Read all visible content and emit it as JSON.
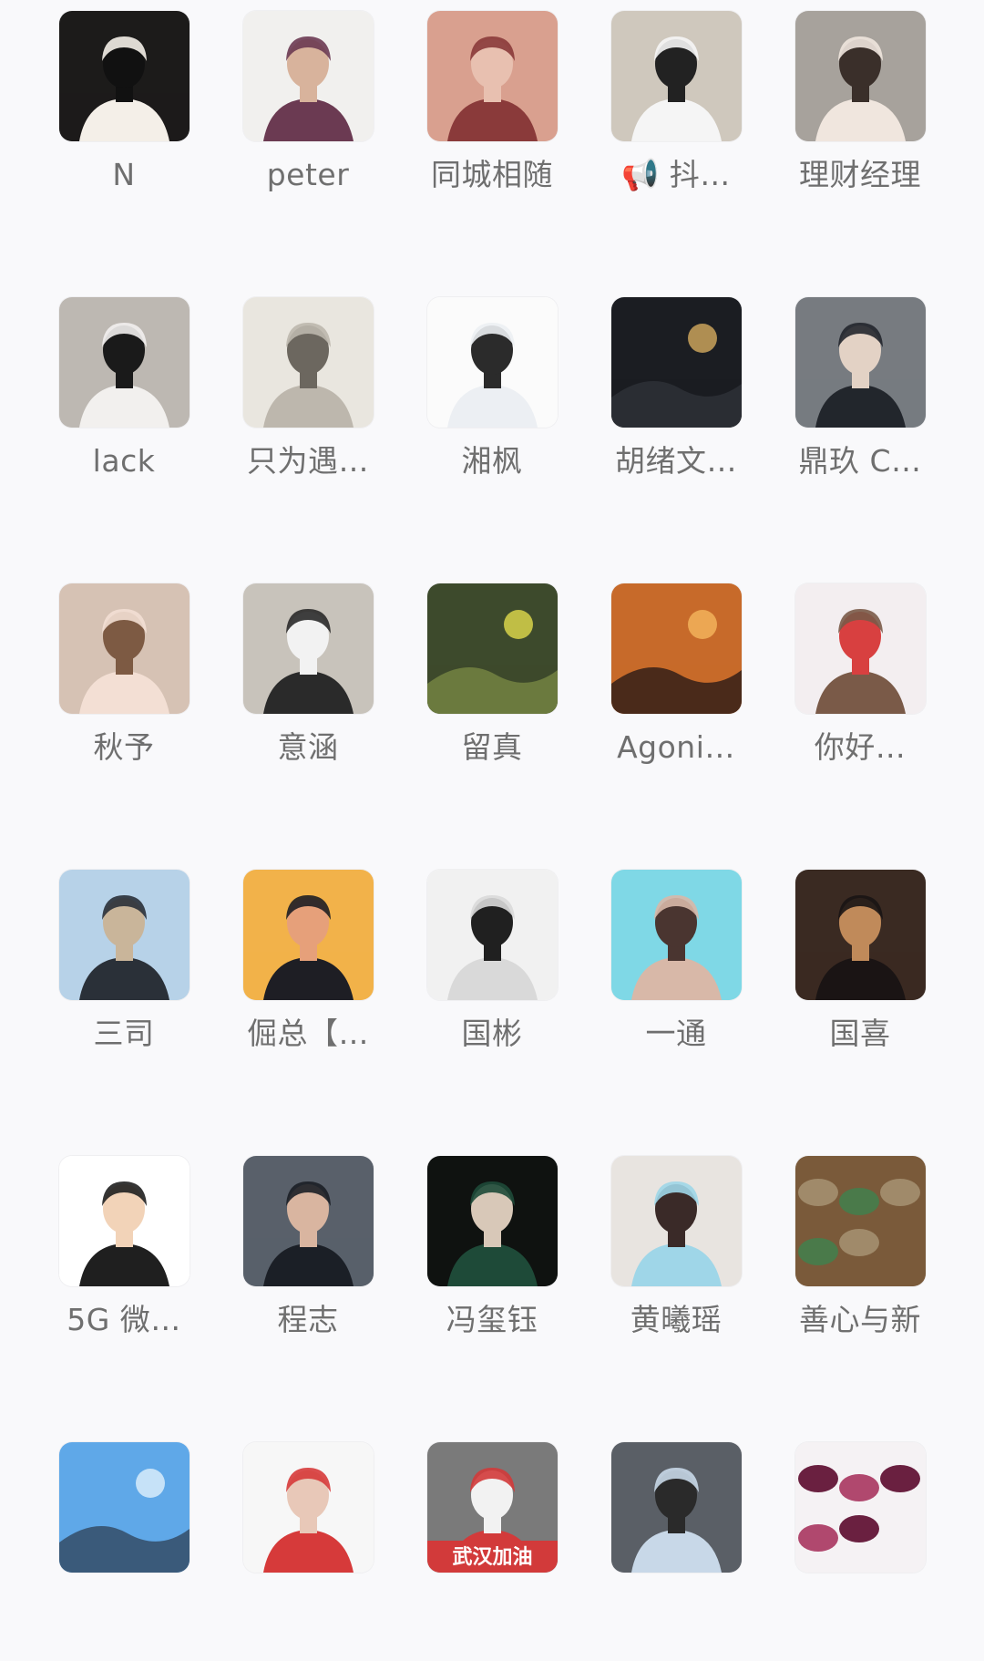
{
  "contacts": [
    {
      "name": "N",
      "icon": "penguin-baby-avatar",
      "colors": [
        "#1c1b1a",
        "#f4efe8",
        "#111111"
      ]
    },
    {
      "name": "peter",
      "icon": "man-portrait-avatar",
      "colors": [
        "#f1f0ee",
        "#6b3a52",
        "#d8b39c"
      ]
    },
    {
      "name": "同城相随",
      "icon": "woman-selfie-avatar",
      "colors": [
        "#d9a08f",
        "#8a3a3a",
        "#e8c0b0"
      ]
    },
    {
      "name": "📢 抖…",
      "icon": "man-sitting-avatar",
      "colors": [
        "#cfc8bd",
        "#f5f5f5",
        "#222222"
      ]
    },
    {
      "name": "理财经理",
      "icon": "woman-scarf-avatar",
      "colors": [
        "#a7a29c",
        "#f0e6de",
        "#3a2f2a"
      ]
    },
    {
      "name": "lack",
      "icon": "cat-sunglasses-avatar",
      "colors": [
        "#bdb8b2",
        "#f2f0ee",
        "#1a1a1a"
      ]
    },
    {
      "name": "只为遇…",
      "icon": "sketch-boy-avatar",
      "colors": [
        "#e9e6df",
        "#bdb7ad",
        "#6c675f"
      ]
    },
    {
      "name": "湘枫",
      "icon": "man-standing-avatar",
      "colors": [
        "#fbfbfb",
        "#eceff3",
        "#2b2b2b"
      ]
    },
    {
      "name": "胡绪文…",
      "icon": "calligraphy-hu-avatar",
      "colors": [
        "#1b1d22",
        "#c9a25a",
        "#2a2d33"
      ]
    },
    {
      "name": "鼎玖 C…",
      "icon": "man-suit-avatar",
      "colors": [
        "#777b80",
        "#22262c",
        "#e3d2c5"
      ]
    },
    {
      "name": "秋予",
      "icon": "girl-face-avatar",
      "colors": [
        "#d6c2b4",
        "#f3dfd4",
        "#7d5a43"
      ]
    },
    {
      "name": "意涵",
      "icon": "woman-office-avatar",
      "colors": [
        "#c8c3bb",
        "#2a2a2a",
        "#f2f2f2"
      ]
    },
    {
      "name": "留真",
      "icon": "clover-avatar",
      "colors": [
        "#3d4a2c",
        "#d7d24a",
        "#6b7a3e"
      ]
    },
    {
      "name": "Agoni…",
      "icon": "sunset-beach-avatar",
      "colors": [
        "#c76a2a",
        "#f2b25a",
        "#4a2a1a"
      ]
    },
    {
      "name": "你好…",
      "icon": "woman-profile-avatar",
      "colors": [
        "#f3eef0",
        "#7a5a48",
        "#d84040"
      ]
    },
    {
      "name": "三司",
      "icon": "man-vest-avatar",
      "colors": [
        "#b7d2e8",
        "#2a3038",
        "#c9b59a"
      ]
    },
    {
      "name": "倔总【…",
      "icon": "anime-ninja-avatar",
      "colors": [
        "#f2b24a",
        "#1e1e24",
        "#e6a07a"
      ]
    },
    {
      "name": "国彬",
      "icon": "man-glasses-avatar",
      "colors": [
        "#f1f1f1",
        "#d9d9d9",
        "#202020"
      ]
    },
    {
      "name": "一通",
      "icon": "woman-video-avatar",
      "colors": [
        "#7fd8e6",
        "#d8b8a8",
        "#4a3530"
      ]
    },
    {
      "name": "国喜",
      "icon": "man-chair-avatar",
      "colors": [
        "#3a2a22",
        "#1a1414",
        "#c08a5a"
      ]
    },
    {
      "name": "5G 微…",
      "icon": "cartoon-man-avatar",
      "colors": [
        "#ffffff",
        "#1f1f1f",
        "#f2d3b8"
      ]
    },
    {
      "name": "程志",
      "icon": "man-business-avatar",
      "colors": [
        "#59606a",
        "#1b1f26",
        "#d9b5a0"
      ]
    },
    {
      "name": "冯玺钰",
      "icon": "woman-dress-avatar",
      "colors": [
        "#0f1210",
        "#1e4a38",
        "#d8c8b8"
      ]
    },
    {
      "name": "黄曦瑶",
      "icon": "woman-blue-avatar",
      "colors": [
        "#e8e4e0",
        "#9fd6e8",
        "#3a2a28"
      ]
    },
    {
      "name": "善心与新",
      "icon": "jade-stones-avatar",
      "colors": [
        "#7a5a3a",
        "#4a7a4a",
        "#a08a6a"
      ]
    },
    {
      "name": "",
      "icon": "sky-landscape-avatar",
      "colors": [
        "#5fa8e8",
        "#d8ecfa",
        "#3a5a7a"
      ]
    },
    {
      "name": "",
      "icon": "girl-hearts-avatar",
      "colors": [
        "#f7f7f7",
        "#d63a3a",
        "#e8c8b8"
      ]
    },
    {
      "name": "",
      "icon": "wuhan-jiayou-avatar",
      "colors": [
        "#7a7a7a",
        "#d23a3a",
        "#f2f2f2"
      ],
      "caption": "武汉加油"
    },
    {
      "name": "",
      "icon": "girl-cup-avatar",
      "colors": [
        "#5a5f66",
        "#c8d8e8",
        "#2a2a2a"
      ]
    },
    {
      "name": "",
      "icon": "glass-dragon-avatar",
      "colors": [
        "#f5f2f4",
        "#b0486e",
        "#6a2040"
      ]
    }
  ]
}
